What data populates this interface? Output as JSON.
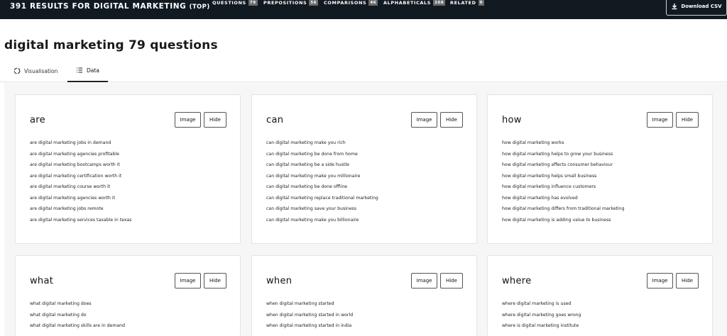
{
  "topbar": {
    "results_text": "391 RESULTS FOR DIGITAL MARKETING",
    "results_suffix": "(TOP)",
    "nav": [
      {
        "label": "QUESTIONS",
        "count": "79"
      },
      {
        "label": "PREPOSITIONS",
        "count": "56"
      },
      {
        "label": "COMPARISONS",
        "count": "46"
      },
      {
        "label": "ALPHABETICALS",
        "count": "208"
      },
      {
        "label": "RELATED",
        "count": "0"
      }
    ],
    "download_label": "Download CSV"
  },
  "page_title": "digital marketing 79 questions",
  "tabs": {
    "visualisation": "Visualisation",
    "data": "Data"
  },
  "card_buttons": {
    "image": "Image",
    "hide": "Hide"
  },
  "cards": [
    {
      "heading": "are",
      "items": [
        "are digital marketing jobs in demand",
        "are digital marketing agencies profitable",
        "are digital marketing bootcamps worth it",
        "are digital marketing certification worth it",
        "are digital marketing course worth it",
        "are digital marketing agencies worth it",
        "are digital marketing jobs remote",
        "are digital marketing services taxable in texas"
      ]
    },
    {
      "heading": "can",
      "items": [
        "can digital marketing make you rich",
        "can digital marketing be done from home",
        "can digital marketing be a side hustle",
        "can digital marketing make you millionaire",
        "can digital marketing be done offline",
        "can digital marketing replace traditional marketing",
        "can digital marketing save your business",
        "can digital marketing make you billionaire"
      ]
    },
    {
      "heading": "how",
      "items": [
        "how digital marketing works",
        "how digital marketing helps to grow your business",
        "how digital marketing affects consumer behaviour",
        "how digital marketing helps small business",
        "how digital marketing influence customers",
        "how digital marketing has evolved",
        "how digital marketing differs from traditional marketing",
        "how digital marketing is adding value to business"
      ]
    },
    {
      "heading": "what",
      "items": [
        "what digital marketing does",
        "what digital marketing do",
        "what digital marketing skills are in demand"
      ]
    },
    {
      "heading": "when",
      "items": [
        "when digital marketing started",
        "when digital marketing started in world",
        "when digital marketing started in india"
      ]
    },
    {
      "heading": "where",
      "items": [
        "where digital marketing is used",
        "where digital marketing goes wrong",
        "where is digital marketing institute"
      ]
    }
  ]
}
